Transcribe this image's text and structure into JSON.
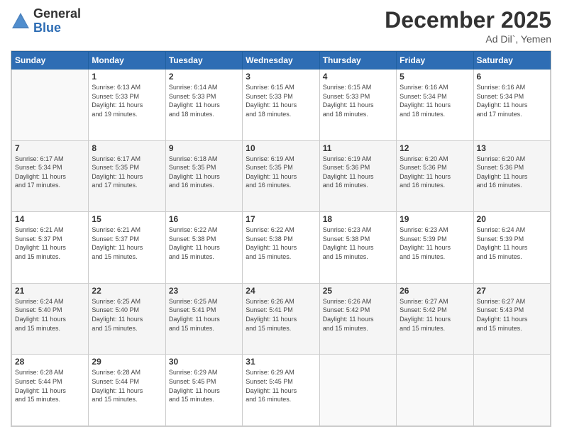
{
  "header": {
    "logo_general": "General",
    "logo_blue": "Blue",
    "month_title": "December 2025",
    "location": "Ad Dil`, Yemen"
  },
  "calendar": {
    "weekdays": [
      "Sunday",
      "Monday",
      "Tuesday",
      "Wednesday",
      "Thursday",
      "Friday",
      "Saturday"
    ],
    "weeks": [
      [
        {
          "day": "",
          "info": ""
        },
        {
          "day": "1",
          "info": "Sunrise: 6:13 AM\nSunset: 5:33 PM\nDaylight: 11 hours\nand 19 minutes."
        },
        {
          "day": "2",
          "info": "Sunrise: 6:14 AM\nSunset: 5:33 PM\nDaylight: 11 hours\nand 18 minutes."
        },
        {
          "day": "3",
          "info": "Sunrise: 6:15 AM\nSunset: 5:33 PM\nDaylight: 11 hours\nand 18 minutes."
        },
        {
          "day": "4",
          "info": "Sunrise: 6:15 AM\nSunset: 5:33 PM\nDaylight: 11 hours\nand 18 minutes."
        },
        {
          "day": "5",
          "info": "Sunrise: 6:16 AM\nSunset: 5:34 PM\nDaylight: 11 hours\nand 18 minutes."
        },
        {
          "day": "6",
          "info": "Sunrise: 6:16 AM\nSunset: 5:34 PM\nDaylight: 11 hours\nand 17 minutes."
        }
      ],
      [
        {
          "day": "7",
          "info": "Sunrise: 6:17 AM\nSunset: 5:34 PM\nDaylight: 11 hours\nand 17 minutes."
        },
        {
          "day": "8",
          "info": "Sunrise: 6:17 AM\nSunset: 5:35 PM\nDaylight: 11 hours\nand 17 minutes."
        },
        {
          "day": "9",
          "info": "Sunrise: 6:18 AM\nSunset: 5:35 PM\nDaylight: 11 hours\nand 16 minutes."
        },
        {
          "day": "10",
          "info": "Sunrise: 6:19 AM\nSunset: 5:35 PM\nDaylight: 11 hours\nand 16 minutes."
        },
        {
          "day": "11",
          "info": "Sunrise: 6:19 AM\nSunset: 5:36 PM\nDaylight: 11 hours\nand 16 minutes."
        },
        {
          "day": "12",
          "info": "Sunrise: 6:20 AM\nSunset: 5:36 PM\nDaylight: 11 hours\nand 16 minutes."
        },
        {
          "day": "13",
          "info": "Sunrise: 6:20 AM\nSunset: 5:36 PM\nDaylight: 11 hours\nand 16 minutes."
        }
      ],
      [
        {
          "day": "14",
          "info": "Sunrise: 6:21 AM\nSunset: 5:37 PM\nDaylight: 11 hours\nand 15 minutes."
        },
        {
          "day": "15",
          "info": "Sunrise: 6:21 AM\nSunset: 5:37 PM\nDaylight: 11 hours\nand 15 minutes."
        },
        {
          "day": "16",
          "info": "Sunrise: 6:22 AM\nSunset: 5:38 PM\nDaylight: 11 hours\nand 15 minutes."
        },
        {
          "day": "17",
          "info": "Sunrise: 6:22 AM\nSunset: 5:38 PM\nDaylight: 11 hours\nand 15 minutes."
        },
        {
          "day": "18",
          "info": "Sunrise: 6:23 AM\nSunset: 5:38 PM\nDaylight: 11 hours\nand 15 minutes."
        },
        {
          "day": "19",
          "info": "Sunrise: 6:23 AM\nSunset: 5:39 PM\nDaylight: 11 hours\nand 15 minutes."
        },
        {
          "day": "20",
          "info": "Sunrise: 6:24 AM\nSunset: 5:39 PM\nDaylight: 11 hours\nand 15 minutes."
        }
      ],
      [
        {
          "day": "21",
          "info": "Sunrise: 6:24 AM\nSunset: 5:40 PM\nDaylight: 11 hours\nand 15 minutes."
        },
        {
          "day": "22",
          "info": "Sunrise: 6:25 AM\nSunset: 5:40 PM\nDaylight: 11 hours\nand 15 minutes."
        },
        {
          "day": "23",
          "info": "Sunrise: 6:25 AM\nSunset: 5:41 PM\nDaylight: 11 hours\nand 15 minutes."
        },
        {
          "day": "24",
          "info": "Sunrise: 6:26 AM\nSunset: 5:41 PM\nDaylight: 11 hours\nand 15 minutes."
        },
        {
          "day": "25",
          "info": "Sunrise: 6:26 AM\nSunset: 5:42 PM\nDaylight: 11 hours\nand 15 minutes."
        },
        {
          "day": "26",
          "info": "Sunrise: 6:27 AM\nSunset: 5:42 PM\nDaylight: 11 hours\nand 15 minutes."
        },
        {
          "day": "27",
          "info": "Sunrise: 6:27 AM\nSunset: 5:43 PM\nDaylight: 11 hours\nand 15 minutes."
        }
      ],
      [
        {
          "day": "28",
          "info": "Sunrise: 6:28 AM\nSunset: 5:44 PM\nDaylight: 11 hours\nand 15 minutes."
        },
        {
          "day": "29",
          "info": "Sunrise: 6:28 AM\nSunset: 5:44 PM\nDaylight: 11 hours\nand 15 minutes."
        },
        {
          "day": "30",
          "info": "Sunrise: 6:29 AM\nSunset: 5:45 PM\nDaylight: 11 hours\nand 15 minutes."
        },
        {
          "day": "31",
          "info": "Sunrise: 6:29 AM\nSunset: 5:45 PM\nDaylight: 11 hours\nand 16 minutes."
        },
        {
          "day": "",
          "info": ""
        },
        {
          "day": "",
          "info": ""
        },
        {
          "day": "",
          "info": ""
        }
      ]
    ]
  }
}
